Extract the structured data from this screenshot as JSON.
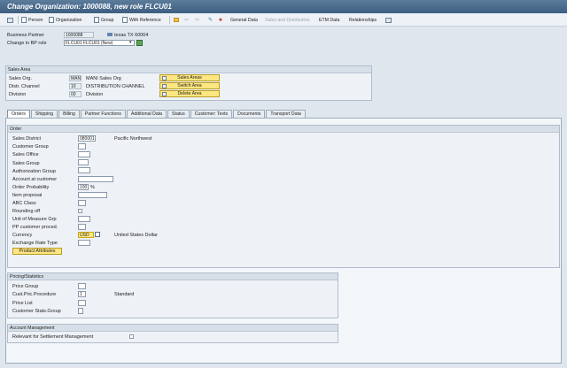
{
  "title": "Change Organization: 1000088, new role FLCU01",
  "toolbar": {
    "person": "Person",
    "organization": "Organization",
    "group": "Group",
    "with_reference": "With Reference",
    "general_data": "General Data",
    "sales_distribution": "Sales and Distribution",
    "etm_data": "ETM Data",
    "relationships": "Relationships"
  },
  "header": {
    "bp_label": "Business Partner",
    "bp_value": "1000088",
    "bp_desc": "texas TX 60004",
    "role_label": "Change in BP role",
    "role_value": "FLCU01 FLCU01 (New)"
  },
  "sales_area": {
    "title": "Sales Area",
    "sales_org_label": "Sales Org.",
    "sales_org_value": "MANI",
    "sales_org_desc": "MANI Sales Org",
    "channel_label": "Distr. Channel",
    "channel_value": "10",
    "channel_desc": "DISTRIBUTION CHANNEL",
    "division_label": "Division",
    "division_value": "00",
    "division_desc": "Division",
    "btn_sales_areas": "Sales Areas",
    "btn_switch": "Switch Area",
    "btn_delete": "Delete Area"
  },
  "tabs": [
    "Orders",
    "Shipping",
    "Billing",
    "Partner Functions",
    "Additional Data",
    "Status",
    "Customer: Texts",
    "Documents",
    "Transport Data"
  ],
  "order": {
    "title": "Order",
    "sales_district_label": "Sales District",
    "sales_district_value": "080001",
    "sales_district_desc": "Pacific Northwest",
    "customer_group": "Customer Group",
    "sales_office": "Sales Office",
    "sales_group": "Sales Group",
    "auth_group": "Authorization Group",
    "account_at_customer": "Account at customer",
    "order_prob_label": "Order Probability",
    "order_prob_value": "100",
    "order_prob_unit": "%",
    "item_proposal": "Item proposal",
    "abc_class": "ABC Class",
    "rounding_off": "Rounding off",
    "uom_grp": "Unit of Measure Grp",
    "pp_cust_proc": "PP customer proced.",
    "currency_label": "Currency",
    "currency_value": "USD",
    "currency_desc": "United States Dollar",
    "exchange_rate_type": "Exchange Rate Type",
    "product_attributes": "Product Attributes"
  },
  "pricing": {
    "title": "Pricing/Statistics",
    "price_group": "Price Group",
    "cust_pric_proc_label": "Cust.Pric.Procedure",
    "cust_pric_proc_value": "1",
    "cust_pric_proc_desc": "Standard",
    "price_list": "Price List",
    "cust_stats_group": "Customer Stats.Group"
  },
  "account": {
    "title": "Account Management",
    "relevant_settlement": "Relevant for Settlement Management"
  }
}
